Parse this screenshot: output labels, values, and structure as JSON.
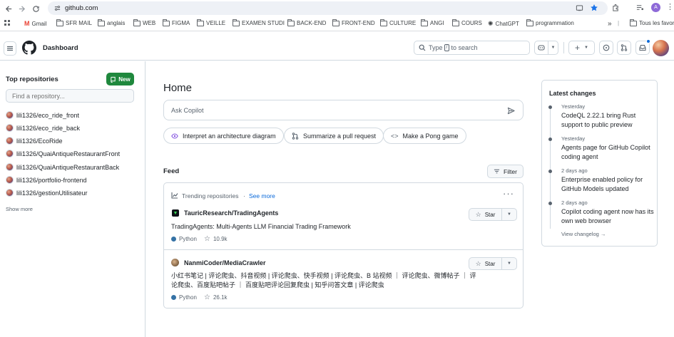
{
  "browser": {
    "url": "github.com",
    "profile_initial": "A",
    "bookmarks": [
      {
        "label": "Gmail",
        "icon": "gmail-icon"
      },
      {
        "label": "SFR MAIL",
        "icon": "folder-icon"
      },
      {
        "label": "anglais",
        "icon": "folder-icon"
      },
      {
        "label": "WEB",
        "icon": "folder-icon"
      },
      {
        "label": "FIGMA",
        "icon": "folder-icon"
      },
      {
        "label": "VEILLE",
        "icon": "folder-icon"
      },
      {
        "label": "EXAMEN STUDI",
        "icon": "folder-icon"
      },
      {
        "label": "BACK-END",
        "icon": "folder-icon"
      },
      {
        "label": "FRONT-END",
        "icon": "folder-icon"
      },
      {
        "label": "CULTURE",
        "icon": "folder-icon"
      },
      {
        "label": "ANGI",
        "icon": "folder-icon"
      },
      {
        "label": "COURS",
        "icon": "folder-icon"
      },
      {
        "label": "ChatGPT",
        "icon": "chatgpt-icon"
      },
      {
        "label": "programmation",
        "icon": "folder-icon"
      }
    ],
    "all_bookmarks_label": "Tous les favoris"
  },
  "header": {
    "title": "Dashboard",
    "search_type": "Type",
    "search_key": "/",
    "search_rest": "to search"
  },
  "sidebar": {
    "title": "Top repositories",
    "new_label": "New",
    "find_placeholder": "Find a repository...",
    "repos": [
      "lili1326/eco_ride_front",
      "lili1326/eco_ride_back",
      "lili1326/EcoRide",
      "lili1326/QuaiAntiqueRestaurantFront",
      "lili1326/QuaiAntiqueRestaurantBack",
      "lili1326/portfolio-frontend",
      "lili1326/gestionUtilisateur"
    ],
    "show_more": "Show more"
  },
  "main": {
    "title": "Home",
    "copilot_placeholder": "Ask Copilot",
    "suggestions": [
      "Interpret an architecture diagram",
      "Summarize a pull request",
      "Make a Pong game"
    ],
    "feed_title": "Feed",
    "filter_label": "Filter",
    "trending_label": "Trending repositories",
    "see_more": "See more",
    "star_label": "Star",
    "repos": [
      {
        "name": "TauricResearch/TradingAgents",
        "description": "TradingAgents: Multi-Agents LLM Financial Trading Framework",
        "language": "Python",
        "stars": "10.9k"
      },
      {
        "name": "NanmiCoder/MediaCrawler",
        "description_line1": "小红书笔记 | 评论爬虫、抖音视频 | 评论爬虫、快手视频 | 评论爬虫、B 站视频 ｜ 评论爬虫、微博帖子 ｜ 评",
        "description_line2": "论爬虫、百度贴吧帖子 ｜ 百度贴吧评论回复爬虫 | 知乎问答文章 | 评论爬虫",
        "language": "Python",
        "stars": "26.1k"
      }
    ]
  },
  "changes": {
    "title": "Latest changes",
    "items": [
      {
        "date": "Yesterday",
        "title": "CodeQL 2.22.1 bring Rust support to public preview"
      },
      {
        "date": "Yesterday",
        "title": "Agents page for GitHub Copilot coding agent"
      },
      {
        "date": "2 days ago",
        "title": "Enterprise enabled policy for GitHub Models updated"
      },
      {
        "date": "2 days ago",
        "title": "Copilot coding agent now has its own web browser"
      }
    ],
    "view_changelog": "View changelog →"
  },
  "colors": {
    "new_button": "#1f883d",
    "python_dot": "#3572A5",
    "bookmark_star": "#1a73e8",
    "border": "#d1d9e0"
  }
}
